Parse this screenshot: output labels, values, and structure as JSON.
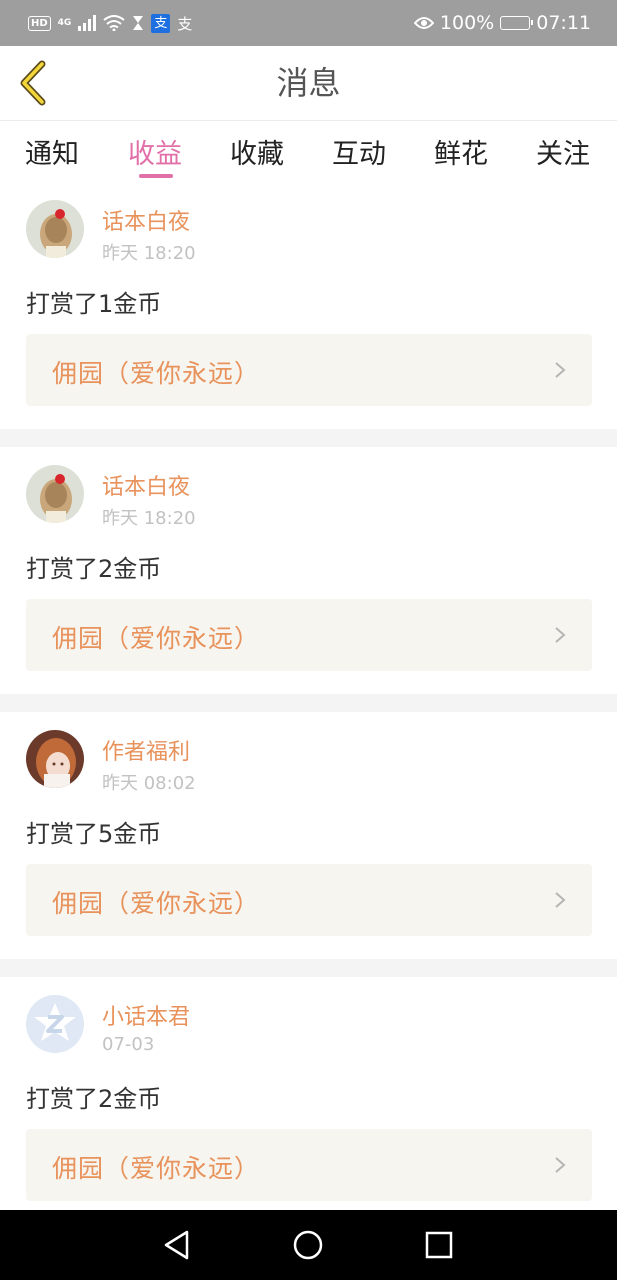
{
  "status_bar": {
    "hd": "HD",
    "signal": "4G",
    "battery": "100%",
    "time": "07:11",
    "alipay_1": "支",
    "alipay_2": "支"
  },
  "header": {
    "title": "消息"
  },
  "tabs": [
    {
      "label": "通知"
    },
    {
      "label": "收益",
      "active": true
    },
    {
      "label": "收藏"
    },
    {
      "label": "互动"
    },
    {
      "label": "鲜花"
    },
    {
      "label": "关注"
    }
  ],
  "messages": [
    {
      "user": "话本白夜",
      "time": "昨天 18:20",
      "text": "打赏了1金币",
      "book": "佣园（爱你永远）",
      "avatar": "girl-back-icon"
    },
    {
      "user": "话本白夜",
      "time": "昨天 18:20",
      "text": "打赏了2金币",
      "book": "佣园（爱你永远）",
      "avatar": "girl-back-icon"
    },
    {
      "user": "作者福利",
      "time": "昨天 08:02",
      "text": "打赏了5金币",
      "book": "佣园（爱你永远）",
      "avatar": "anime-girl-icon"
    },
    {
      "user": "小话本君",
      "time": "07-03",
      "text": "打赏了2金币",
      "book": "佣园（爱你永远）",
      "avatar": "z-logo-icon"
    }
  ],
  "colors": {
    "accent_pink": "#e270a8",
    "accent_orange": "#e8925c",
    "status_bar": "#9e9e9e"
  }
}
